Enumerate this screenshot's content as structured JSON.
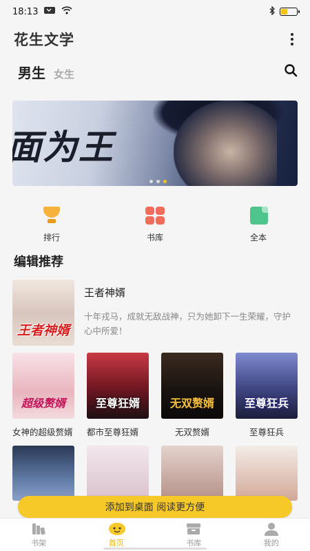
{
  "status": {
    "time": "18:13"
  },
  "app": {
    "title": "花生文学"
  },
  "tabs": {
    "active": "男生",
    "inactive": "女生"
  },
  "quick_nav": [
    {
      "label": "排行",
      "icon": "trophy-icon"
    },
    {
      "label": "书库",
      "icon": "grid-icon"
    },
    {
      "label": "全本",
      "icon": "book-complete-icon"
    }
  ],
  "banner": {
    "title": "面为王"
  },
  "section": {
    "title": "编辑推荐"
  },
  "featured": {
    "name": "王者神婿",
    "cover_text": "王者神婿",
    "description": "十年戎马，成就无敌战神，只为她卸下一生荣耀，守护心中所爱！"
  },
  "books": [
    {
      "title": "女神的超级赘婿",
      "cover_text": "超级赘婿"
    },
    {
      "title": "都市至尊狂婿",
      "cover_text": "至尊狂婿"
    },
    {
      "title": "无双赘婿",
      "cover_text": "无双赘婿"
    },
    {
      "title": "至尊狂兵",
      "cover_text": "至尊狂兵"
    }
  ],
  "toast": {
    "text": "添加到桌面 阅读更方便"
  },
  "bottom_nav": [
    {
      "label": "书架"
    },
    {
      "label": "首页"
    },
    {
      "label": "书库"
    },
    {
      "label": "我的"
    }
  ],
  "colors": {
    "accent": "#f7c928",
    "active_tab": "#f4b400"
  }
}
